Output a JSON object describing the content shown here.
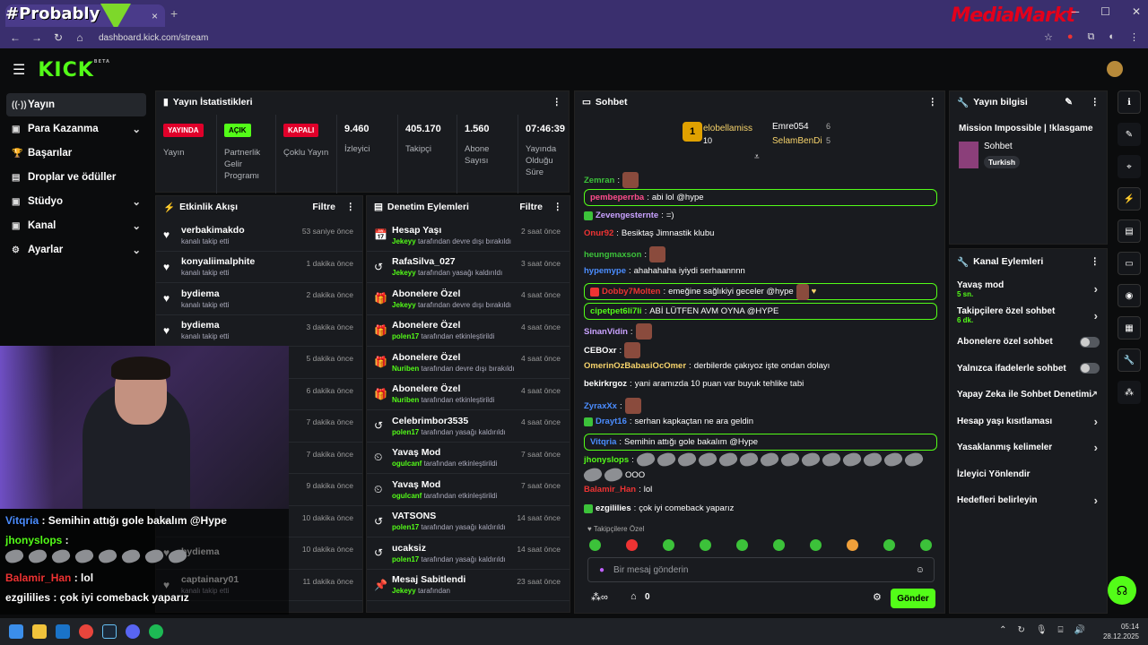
{
  "browser": {
    "overlay_brand": "#Probably",
    "media_brand": "MediaMarkt",
    "url": "dashboard.kick.com/stream",
    "tab_close": "×",
    "new_tab": "+"
  },
  "nav": {
    "items": [
      {
        "label": "Yayın",
        "icon": "broadcast-icon"
      },
      {
        "label": "Para Kazanma",
        "icon": "money-icon"
      },
      {
        "label": "Başarılar",
        "icon": "trophy-icon"
      },
      {
        "label": "Droplar ve ödüller",
        "icon": "gift-icon"
      },
      {
        "label": "Stüdyo",
        "icon": "studio-icon"
      },
      {
        "label": "Kanal",
        "icon": "channel-icon"
      },
      {
        "label": "Ayarlar",
        "icon": "gear-icon"
      }
    ]
  },
  "stats": {
    "title": "Yayın İstatistikleri",
    "items": [
      {
        "badge": "YAYINDA",
        "label": "Yayın"
      },
      {
        "badge": "AÇIK",
        "label": "Partnerlik Gelir Programı"
      },
      {
        "badge": "KAPALI",
        "label": "Çoklu Yayın"
      },
      {
        "value": "9.460",
        "label": "İzleyici"
      },
      {
        "value": "405.170",
        "label": "Takipçi"
      },
      {
        "value": "1.560",
        "label": "Abone Sayısı"
      },
      {
        "value": "07:46:39",
        "label": "Yayında Olduğu Süre"
      }
    ]
  },
  "activity": {
    "title": "Etkinlik Akışı",
    "filter": "Filtre",
    "rows": [
      {
        "name": "verbakimakdo",
        "desc": "kanalı takip etti",
        "time": "53 saniye önce"
      },
      {
        "name": "konyaliimalphite",
        "desc": "kanalı takip etti",
        "time": "1 dakika önce"
      },
      {
        "name": "bydiema",
        "desc": "kanalı takip etti",
        "time": "2 dakika önce"
      },
      {
        "name": "bydiema",
        "desc": "kanalı takip etti",
        "time": "3 dakika önce"
      },
      {
        "name": "",
        "desc": "",
        "time": "5 dakika önce"
      },
      {
        "name": "",
        "desc": "",
        "time": "6 dakika önce"
      },
      {
        "name": "",
        "desc": "",
        "time": "7 dakika önce"
      },
      {
        "name": "",
        "desc": "",
        "time": "7 dakika önce"
      },
      {
        "name": "",
        "desc": "",
        "time": "9 dakika önce"
      },
      {
        "name": "",
        "desc": "",
        "time": "10 dakika önce"
      },
      {
        "name": "bydiema",
        "desc": "",
        "time": "10 dakika önce"
      },
      {
        "name": "captainary01",
        "desc": "kanalı takip etti",
        "time": "11 dakika önce"
      }
    ]
  },
  "moderation": {
    "title": "Denetim Eylemleri",
    "filter": "Filtre",
    "rows": [
      {
        "name": "Hesap Yaşı",
        "who": "Jekeyy",
        "desc": "tarafından devre dışı bırakıldı",
        "time": "2 saat önce"
      },
      {
        "name": "RafaSilva_027",
        "who": "Jekeyy",
        "desc": "tarafından yasağı kaldırıldı",
        "time": "3 saat önce"
      },
      {
        "name": "Abonelere Özel",
        "who": "Jekeyy",
        "desc": "tarafından devre dışı bırakıldı",
        "time": "4 saat önce"
      },
      {
        "name": "Abonelere Özel",
        "who": "polen17",
        "desc": "tarafından etkinleştirildi",
        "time": "4 saat önce"
      },
      {
        "name": "Abonelere Özel",
        "who": "Nuriben",
        "desc": "tarafından devre dışı bırakıldı",
        "time": "4 saat önce"
      },
      {
        "name": "Abonelere Özel",
        "who": "Nuriben",
        "desc": "tarafından etkinleştirildi",
        "time": "4 saat önce"
      },
      {
        "name": "Celebrimbor3535",
        "who": "polen17",
        "desc": "tarafından yasağı kaldırıldı",
        "time": "4 saat önce"
      },
      {
        "name": "Yavaş Mod",
        "who": "ogulcanf",
        "desc": "tarafından etkinleştirildi",
        "time": "7 saat önce"
      },
      {
        "name": "Yavaş Mod",
        "who": "ogulcanf",
        "desc": "tarafından etkinleştirildi",
        "time": "7 saat önce"
      },
      {
        "name": "VATSONS",
        "who": "polen17",
        "desc": "tarafından yasağı kaldırıldı",
        "time": "14 saat önce"
      },
      {
        "name": "ucaksiz",
        "who": "polen17",
        "desc": "tarafından yasağı kaldırıldı",
        "time": "14 saat önce"
      },
      {
        "name": "Mesaj Sabitlendi",
        "who": "Jekeyy",
        "desc": "tarafından",
        "time": "23 saat önce"
      }
    ]
  },
  "chat": {
    "title": "Sohbet",
    "top1": "elobellamiss",
    "top1_count": "10",
    "top2": "Emre054",
    "top2_count": "6",
    "top3": "SelamBenDi",
    "top3_count": "5",
    "messages": [
      {
        "user": "Zemran",
        "text": "",
        "color": "#3cc23a"
      },
      {
        "user": "pembeperrba",
        "text": "abi lol @hype",
        "color": "#ff4d8d"
      },
      {
        "user": "Zevengesternte",
        "text": "=)",
        "color": "#c9a2ff"
      },
      {
        "user": "Onur92",
        "text": "Besiktaş Jimnastik klubu",
        "color": "#e33"
      },
      {
        "user": "heungmaxson",
        "text": "",
        "color": "#3cc23a"
      },
      {
        "user": "hypemype",
        "text": "ahahahaha iyiydi serhaannnn",
        "color": "#4b8dff"
      },
      {
        "user": "Dobby7Molten",
        "text": "emeğine sağlıkiyi geceler @hype",
        "color": "#e33"
      },
      {
        "user": "cipetpet6li7li",
        "text": "ABİ LÜTFEN AVM OYNA @HYPE",
        "color": "#53fc18"
      },
      {
        "user": "SinanVidin",
        "text": "",
        "color": "#c9a2ff"
      },
      {
        "user": "CEBOxr",
        "text": "",
        "color": "#fff"
      },
      {
        "user": "OmerinOzBabasiOcOmer",
        "text": "derbilerde çakıyoz işte ondan dolayı",
        "color": "#f6d36b"
      },
      {
        "user": "bekirkrgoz",
        "text": "yani aramızda 10 puan var buyuk tehlike tabi",
        "color": "#fff"
      },
      {
        "user": "ZyraxXx",
        "text": "",
        "color": "#4b8dff"
      },
      {
        "user": "Drayt16",
        "text": "serhan kapkaçtan ne ara geldin",
        "color": "#4b8dff"
      },
      {
        "user": "Vitqria",
        "text": "Semihin attığı gole bakalım @Hype",
        "color": "#4b8dff"
      },
      {
        "user": "jhonyslops",
        "text": "OOO",
        "color": "#53fc18"
      },
      {
        "user": "Balamir_Han",
        "text": "lol",
        "color": "#e33"
      },
      {
        "user": "ezgililies",
        "text": "çok iyi comeback yaparız",
        "color": "#fff"
      }
    ],
    "followers_only": "Takipçilere Özel",
    "placeholder": "Bir mesaj gönderin",
    "points": "0",
    "send": "Gönder"
  },
  "info": {
    "title": "Yayın bilgisi",
    "stream_title": "Mission Impossible | !klasgame",
    "category": "Sohbet",
    "tag": "Turkish"
  },
  "actions": {
    "title": "Kanal Eylemleri",
    "rows": [
      {
        "label": "Yavaş mod",
        "sub": "5 sn.",
        "type": "arrow"
      },
      {
        "label": "Takipçilere özel sohbet",
        "sub": "6 dk.",
        "type": "arrow"
      },
      {
        "label": "Abonelere özel sohbet",
        "sub": "",
        "type": "toggle"
      },
      {
        "label": "Yalnızca ifadelerle sohbet",
        "sub": "",
        "type": "toggle"
      },
      {
        "label": "Yapay Zeka ile Sohbet Denetimi",
        "sub": "",
        "type": "external"
      },
      {
        "label": "Hesap yaşı kısıtlaması",
        "sub": "",
        "type": "arrow"
      },
      {
        "label": "Yasaklanmış kelimeler",
        "sub": "",
        "type": "arrow"
      },
      {
        "label": "İzleyici Yönlendir",
        "sub": "",
        "type": "none"
      },
      {
        "label": "Hedefleri belirleyin",
        "sub": "",
        "type": "arrow"
      }
    ]
  },
  "overlay_chat": [
    {
      "user": "Vitqria",
      "text": "Semihin attığı gole bakalım @Hype",
      "color": "#4b8dff"
    },
    {
      "user": "jhonyslops",
      "text": "",
      "color": "#53fc18"
    },
    {
      "user": "Balamir_Han",
      "text": "lol",
      "color": "#e33"
    },
    {
      "user": "ezgililies",
      "text": "çok iyi comeback yaparız",
      "color": "#fff"
    }
  ],
  "taskbar": {
    "time": "05:14",
    "date": "28.12.2025"
  }
}
